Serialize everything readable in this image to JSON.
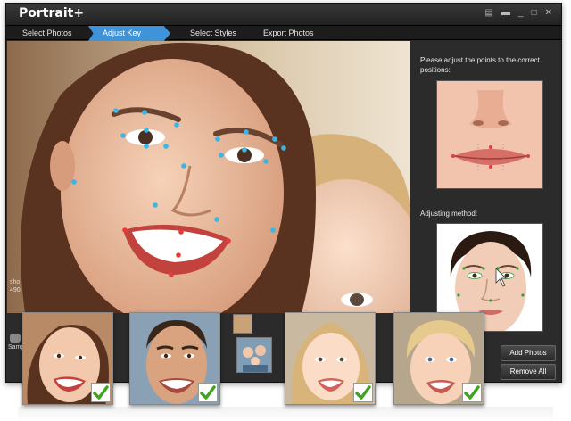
{
  "app": {
    "title": "Portrait+"
  },
  "window_controls": [
    "▤",
    "▬",
    "_",
    "□",
    "✕"
  ],
  "steps": [
    {
      "label": "Select Photos"
    },
    {
      "label": "Adjust Key Points"
    },
    {
      "label": "Select Styles"
    },
    {
      "label": "Export Photos"
    }
  ],
  "active_step": "Adjust Key Points",
  "panel": {
    "instruction": "Please adjust the points to the correct positions:",
    "method_label": "Adjusting method:"
  },
  "photo_info": {
    "line1": "sho",
    "line2": "490"
  },
  "sample": {
    "label": "Samp"
  },
  "buttons": {
    "add_photos": "Add Photos",
    "remove_all": "Remove All"
  },
  "colors": {
    "accent": "#3f93d9",
    "keypoint_blue": "#38b6e8",
    "keypoint_red": "#e83a3a",
    "check_green": "#3fa51f"
  }
}
